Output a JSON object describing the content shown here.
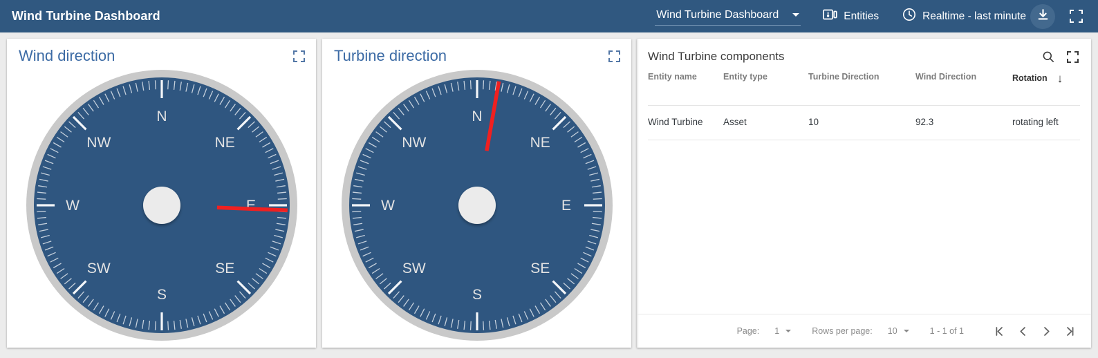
{
  "toolbar": {
    "title": "Wind Turbine Dashboard",
    "dashboard_select": {
      "value": "Wind Turbine Dashboard",
      "caret_icon": "chevron-down-icon"
    },
    "entities": {
      "label": "Entities",
      "icon": "entities-icon"
    },
    "timewindow": {
      "label": "Realtime - last minute",
      "icon": "clock-icon"
    },
    "download": {
      "icon": "download-icon"
    },
    "fullscreen": {
      "icon": "fullscreen-icon"
    }
  },
  "widgets": {
    "wind": {
      "title": "Wind direction",
      "expand_icon": "expand-icon",
      "value": 92.3,
      "labels": [
        "N",
        "NE",
        "E",
        "SE",
        "S",
        "SW",
        "W",
        "NW"
      ]
    },
    "turbine": {
      "title": "Turbine direction",
      "expand_icon": "expand-icon",
      "value": 10,
      "labels": [
        "N",
        "NE",
        "E",
        "SE",
        "S",
        "SW",
        "W",
        "NW"
      ]
    }
  },
  "table": {
    "title": "Wind Turbine components",
    "search_icon": "search-icon",
    "fullscreen_icon": "fullscreen-icon",
    "columns": [
      {
        "label": "Entity name",
        "sorted": false
      },
      {
        "label": "Entity type",
        "sorted": false
      },
      {
        "label": "Turbine Direction",
        "sorted": false
      },
      {
        "label": "Wind Direction",
        "sorted": false
      },
      {
        "label": "Rotation",
        "sorted": true,
        "sort_arrow": "↓"
      }
    ],
    "rows": [
      {
        "entity_name": "Wind Turbine",
        "entity_type": "Asset",
        "turbine_direction": "10",
        "wind_direction": "92.3",
        "rotation": "rotating left"
      }
    ],
    "paginator": {
      "page_label": "Page:",
      "page_value": "1",
      "rows_per_page_label": "Rows per page:",
      "rows_per_page_value": "10",
      "range": "1 - 1 of 1",
      "first_icon": "first-page-icon",
      "prev_icon": "previous-page-icon",
      "next_icon": "next-page-icon",
      "last_icon": "last-page-icon"
    }
  },
  "colors": {
    "toolbar_bg": "#305880",
    "compass_face": "#2f5680",
    "compass_ring": "#c9c9c9",
    "needle": "#f02020",
    "widget_title": "#3c6ba5",
    "page_bg": "#ececec"
  },
  "chart_data": [
    {
      "type": "gauge",
      "title": "Wind direction",
      "value": 92.3,
      "unit": "degrees",
      "range": [
        0,
        360
      ],
      "tick_labels": [
        "N",
        "NE",
        "E",
        "SE",
        "S",
        "SW",
        "W",
        "NW"
      ],
      "tick_angles": [
        0,
        45,
        90,
        135,
        180,
        225,
        270,
        315
      ],
      "minor_tick_step": 3,
      "major_tick_step": 45
    },
    {
      "type": "gauge",
      "title": "Turbine direction",
      "value": 10,
      "unit": "degrees",
      "range": [
        0,
        360
      ],
      "tick_labels": [
        "N",
        "NE",
        "E",
        "SE",
        "S",
        "SW",
        "W",
        "NW"
      ],
      "tick_angles": [
        0,
        45,
        90,
        135,
        180,
        225,
        270,
        315
      ],
      "minor_tick_step": 3,
      "major_tick_step": 45
    }
  ]
}
